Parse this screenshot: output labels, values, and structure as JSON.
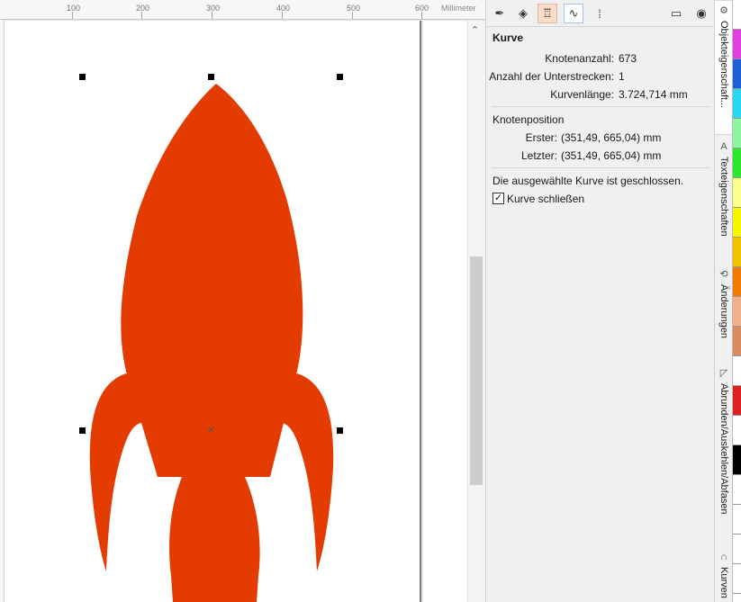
{
  "ruler": {
    "labels": [
      "100",
      "200",
      "300",
      "400",
      "500",
      "600"
    ],
    "unit": "Millimeter"
  },
  "toolbar": {
    "icons": [
      "pen-icon",
      "fill-bucket-icon",
      "transparency-icon",
      "curve-icon",
      "text-frame-icon",
      "frame-icon",
      "view-icon"
    ]
  },
  "properties": {
    "section_curve": "Kurve",
    "node_count_label": "Knotenanzahl:",
    "node_count_value": "673",
    "subpath_label": "Anzahl der Unterstrecken:",
    "subpath_value": "1",
    "length_label": "Kurvenlänge:",
    "length_value": "3.724,714 mm",
    "section_node_position": "Knotenposition",
    "first_label": "Erster:",
    "first_value": "(351,49, 665,04) mm",
    "last_label": "Letzter:",
    "last_value": "(351,49, 665,04) mm",
    "closed_message": "Die ausgewählte Kurve ist geschlossen.",
    "close_curve_label": "Kurve schließen",
    "close_curve_checked": true
  },
  "vertical_tabs": [
    {
      "label": "Objekteigenschaft...",
      "icon": "object-properties-icon",
      "active": true
    },
    {
      "label": "Texteigenschaften",
      "icon": "text-properties-icon",
      "active": false
    },
    {
      "label": "Änderungen",
      "icon": "changes-icon",
      "active": false
    },
    {
      "label": "Abrunden/Auskehlen/Abfasen",
      "icon": "fillet-icon",
      "active": false
    },
    {
      "label": "Kurven",
      "icon": "curves-icon",
      "active": false
    }
  ],
  "palette_colors": [
    "#ffffff",
    "#e23fe0",
    "#1f5fd8",
    "#2ad7f0",
    "#8ff5a0",
    "#2ee82e",
    "#fbff8c",
    "#f6f600",
    "#f0c500",
    "#f07b00",
    "#f0b08a",
    "#d88a60",
    "#ffffff",
    "#e02020",
    "#ffffff",
    "#000000",
    "#ffffff",
    "#ffffff",
    "#ffffff",
    "#ffffff"
  ],
  "shape_fill": "#e33b00"
}
